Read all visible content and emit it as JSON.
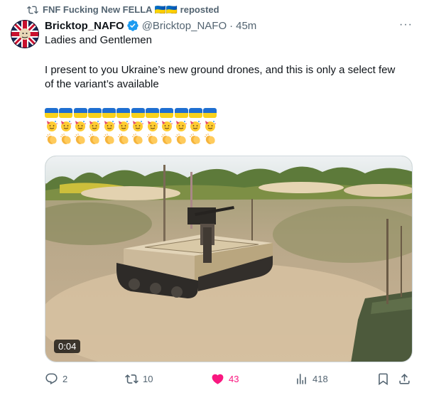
{
  "repost": {
    "icon": "repost-icon",
    "text": "FNF Fucking New FELLA 🇺🇦🇺🇦 reposted"
  },
  "post": {
    "author_name": "Bricktop_NAFO",
    "handle": "@Bricktop_NAFO",
    "separator": "·",
    "time": "45m",
    "more_label": "···",
    "text_line1": "Ladies and Gentlemen",
    "text_line2": "I present to you Ukraine’s new ground drones, and this is only a select few",
    "text_line3": "of the variant’s available",
    "emoji_rows": [
      {
        "emoji": "ukraine-flag",
        "count": 12
      },
      {
        "emoji": "party-face-emoji",
        "count": 12
      },
      {
        "emoji": "clapping-hands-emoji",
        "count": 12
      }
    ]
  },
  "video": {
    "timecode": "0:04",
    "description_icon": "video-frame"
  },
  "actions": {
    "reply_count": "2",
    "repost_count": "10",
    "like_count": "43",
    "views_count": "418"
  },
  "colors": {
    "text": "#0f1419",
    "secondary": "#536471",
    "like": "#f91880",
    "verified": "#1d9bf0",
    "flag_blue": "#1f6fd1",
    "flag_yellow": "#f8d21c"
  }
}
